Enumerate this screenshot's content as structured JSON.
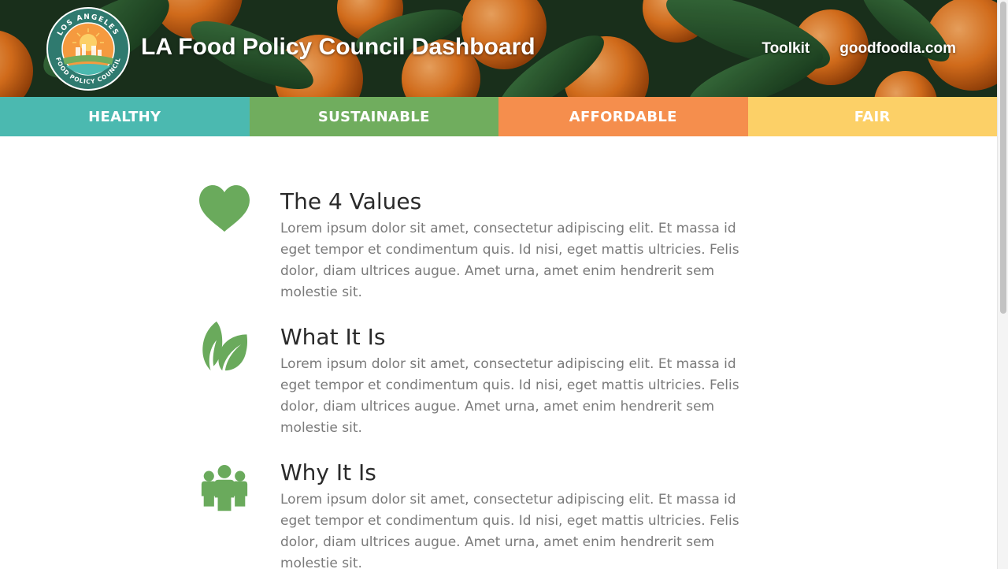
{
  "header": {
    "title": "LA Food Policy Council Dashboard",
    "logo": {
      "text_top": "LOS ANGELES",
      "text_bottom": "FOOD POLICY COUNCIL"
    },
    "nav": [
      {
        "label": "Toolkit"
      },
      {
        "label": "goodfoodla.com"
      }
    ]
  },
  "tabs": [
    {
      "label": "HEALTHY",
      "color": "#4bb9b0"
    },
    {
      "label": "SUSTAINABLE",
      "color": "#70ad5e"
    },
    {
      "label": "AFFORDABLE",
      "color": "#f58e4d"
    },
    {
      "label": "FAIR",
      "color": "#fcd067"
    }
  ],
  "sections": [
    {
      "icon": "heart-icon",
      "heading": "The 4 Values",
      "body": "Lorem ipsum dolor sit amet, consectetur adipiscing elit. Et massa id eget tempor et condimentum quis. Id nisi, eget mattis ultricies. Felis dolor, diam ultrices augue. Amet urna, amet enim hendrerit sem molestie sit."
    },
    {
      "icon": "leaf-icon",
      "heading": "What It Is",
      "body": "Lorem ipsum dolor sit amet, consectetur adipiscing elit. Et massa id eget tempor et condimentum quis. Id nisi, eget mattis ultricies. Felis dolor, diam ultrices augue. Amet urna, amet enim hendrerit sem molestie sit."
    },
    {
      "icon": "people-group-icon",
      "heading": "Why It Is",
      "body": "Lorem ipsum dolor sit amet, consectetur adipiscing elit. Et massa id eget tempor et condimentum quis. Id nisi, eget mattis ultricies. Felis dolor, diam ultrices augue. Amet urna, amet enim hendrerit sem molestie sit."
    }
  ],
  "colors": {
    "icon": "#6aaa5c",
    "heading": "#2a2a2a",
    "body_text": "#7a7a7a"
  }
}
